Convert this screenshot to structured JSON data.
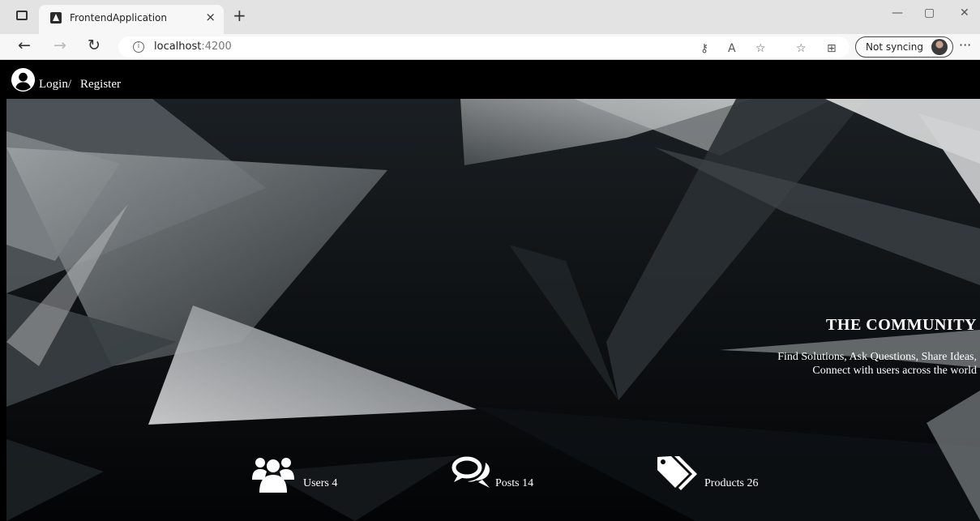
{
  "browser": {
    "tab_title": "FrontendApplication",
    "tab_close": "×",
    "new_tab": "+",
    "url_host": "localhost",
    "url_port": ":4200",
    "info_glyph": "i",
    "sync_label": "Not syncing",
    "more": "···",
    "back": "←",
    "forward": "→",
    "refresh": "↻",
    "minimize": "—",
    "restore": "▢",
    "close": "✕",
    "icons": [
      "password-key-icon",
      "read-aloud-icon",
      "add-favorite-icon",
      "favorites-icon",
      "collections-icon",
      "profile-avatar-icon"
    ]
  },
  "nav": {
    "login_label": "Login/",
    "register_label": "Register",
    "login_icon": "user-circle-icon"
  },
  "hero": {
    "title": "THE COMMUNITY",
    "subtitle_line1": "Find Solutions, Ask Questions, Share Ideas,",
    "subtitle_line2": "Connect with users across the world"
  },
  "stats": [
    {
      "label": "Users 4",
      "icon": "users-group-icon"
    },
    {
      "label": "Posts 14",
      "icon": "comments-icon"
    },
    {
      "label": "Products 26",
      "icon": "tags-icon"
    }
  ],
  "colors": {
    "background": "#000000",
    "text": "#ffffff",
    "chrome": "#f7f7f7"
  }
}
